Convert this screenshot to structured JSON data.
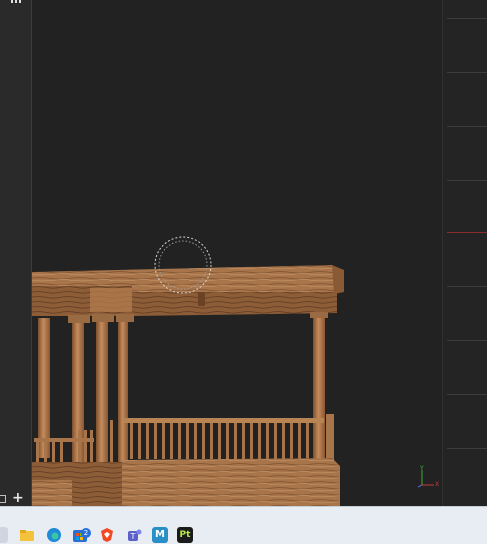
{
  "viewport": {
    "axis": {
      "y": "Y",
      "x": "X"
    }
  },
  "left_panel": {
    "add_label": "+"
  },
  "taskbar": {
    "icons": [
      "file-explorer-icon",
      "edge-browser-icon",
      "store-icon",
      "brave-browser-icon",
      "teams-icon",
      "m-app-icon",
      "pt-app-icon"
    ],
    "badge_count": "2",
    "m_label": "M",
    "pt_label": "Pt"
  },
  "colors": {
    "viewport_bg": "#222222",
    "wood_light": "#b98457",
    "wood_dark": "#6b4226",
    "axis_y": "#3fae3f",
    "axis_x": "#cf3b3b"
  }
}
